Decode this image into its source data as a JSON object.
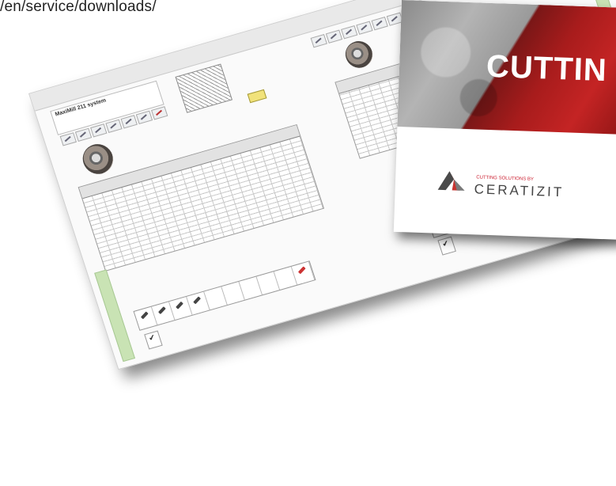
{
  "header": {
    "url_fragment": "/en/service/downloads/"
  },
  "catalogue_page": {
    "title": "MaxiMill 211 system",
    "subtitle": "",
    "side_label_left": "",
    "side_label_right": ""
  },
  "cover": {
    "title": "CUTTIN",
    "logo_tagline": "CUTTING SOLUTIONS BY",
    "logo_brand": "CERATIZIT",
    "logo_color": "#c8332f"
  }
}
